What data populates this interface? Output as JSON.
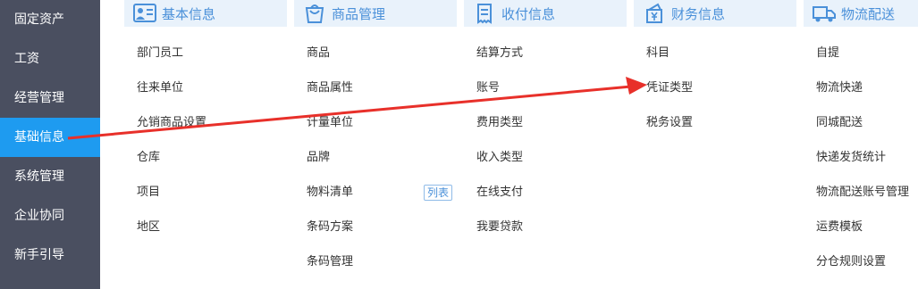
{
  "sidebar": {
    "items": [
      {
        "label": "固定资产"
      },
      {
        "label": "工资"
      },
      {
        "label": "经营管理"
      },
      {
        "label": "基础信息"
      },
      {
        "label": "系统管理"
      },
      {
        "label": "企业协同"
      },
      {
        "label": "新手引导"
      }
    ]
  },
  "columns": [
    {
      "title": "基本信息",
      "icon": "basic-info-icon",
      "items": [
        "部门员工",
        "往来单位",
        "允销商品设置",
        "仓库",
        "项目",
        "地区"
      ]
    },
    {
      "title": "商品管理",
      "icon": "goods-bag-icon",
      "items": [
        "商品",
        "商品属性",
        "计量单位",
        "品牌",
        "物料清单",
        "条码方案",
        "条码管理"
      ],
      "badge": "列表"
    },
    {
      "title": "收付信息",
      "icon": "receipt-icon",
      "items": [
        "结算方式",
        "账号",
        "费用类型",
        "收入类型",
        "在线支付",
        "我要贷款"
      ]
    },
    {
      "title": "财务信息",
      "icon": "finance-yen-icon",
      "items": [
        "科目",
        "凭证类型",
        "税务设置"
      ]
    },
    {
      "title": "物流配送",
      "icon": "delivery-truck-icon",
      "items": [
        "自提",
        "物流快递",
        "同城配送",
        "快递发货统计",
        "物流配送账号管理",
        "运费模板",
        "分仓规则设置"
      ]
    }
  ],
  "colors": {
    "sidebar_bg": "#4a4f60",
    "sidebar_active": "#1e9bf0",
    "header_bg": "#e9f2fb",
    "header_text": "#4a90d9",
    "arrow": "#e8302a"
  }
}
